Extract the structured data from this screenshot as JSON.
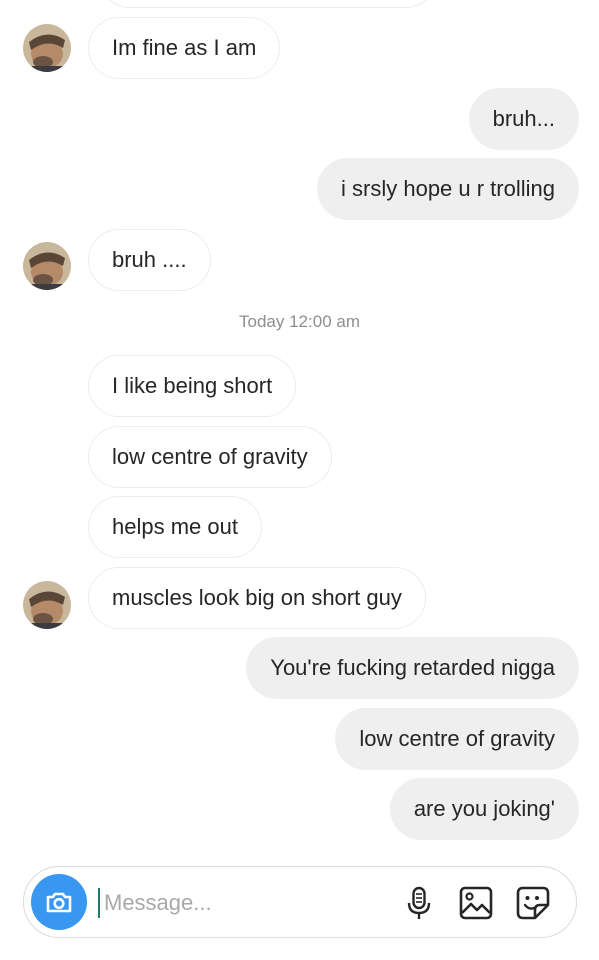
{
  "conversation": {
    "messages": [
      {
        "text": "Im fine as I am"
      },
      {
        "text": "bruh..."
      },
      {
        "text": "i srsly hope u r trolling"
      },
      {
        "text": "bruh ...."
      },
      {
        "text": "I like being short"
      },
      {
        "text": "low centre of gravity"
      },
      {
        "text": "helps me out"
      },
      {
        "text": "muscles look big on short guy"
      },
      {
        "text": "You're fucking retarded nigga"
      },
      {
        "text": "low centre of gravity"
      },
      {
        "text": "are you joking'"
      }
    ],
    "timestamp": "Today 12:00 am"
  },
  "composer": {
    "placeholder": "Message...",
    "value": "",
    "icons": {
      "camera": "camera-icon",
      "microphone": "microphone-icon",
      "gallery": "gallery-icon",
      "sticker": "sticker-icon"
    }
  },
  "colors": {
    "outgoing_bubble": "#efefef",
    "incoming_border": "#ececec",
    "accent": "#3897f0",
    "timestamp_text": "#8e8e8e"
  }
}
